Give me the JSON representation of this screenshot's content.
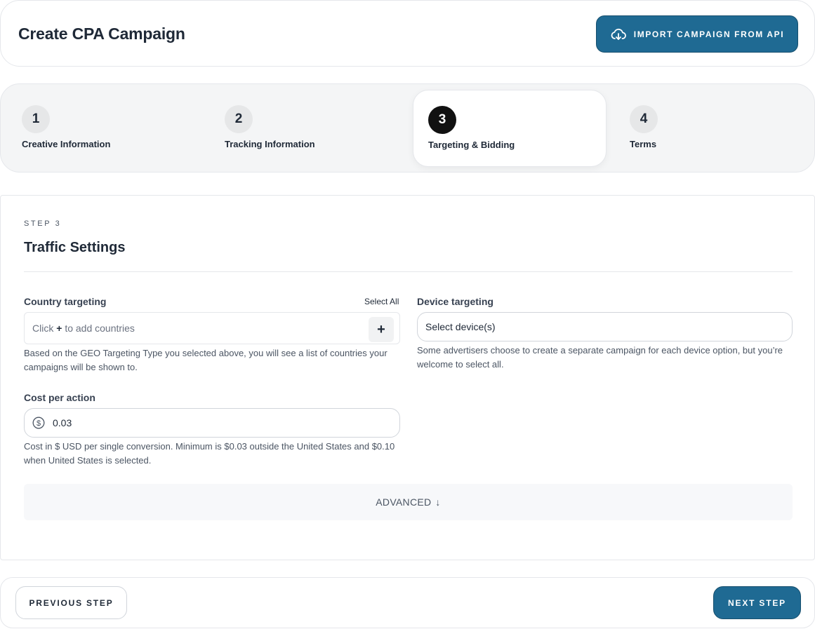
{
  "header": {
    "title": "Create CPA Campaign",
    "import_button": "IMPORT CAMPAIGN FROM API"
  },
  "steps": [
    {
      "number": "1",
      "label": "Creative Information",
      "active": false
    },
    {
      "number": "2",
      "label": "Tracking Information",
      "active": false
    },
    {
      "number": "3",
      "label": "Targeting & Bidding",
      "active": true
    },
    {
      "number": "4",
      "label": "Terms",
      "active": false
    }
  ],
  "form": {
    "kicker": "STEP 3",
    "title": "Traffic Settings",
    "country": {
      "label": "Country targeting",
      "select_all": "Select All",
      "placeholder_prefix": "Click",
      "placeholder_plus": "+",
      "placeholder_suffix": "to add countries",
      "add_button": "+",
      "help": "Based on the GEO Targeting Type you selected above, you will see a list of countries your campaigns will be shown to."
    },
    "device": {
      "label": "Device targeting",
      "value": "Select device(s)",
      "help": "Some advertisers choose to create a separate campaign for each device option, but you’re welcome to select all."
    },
    "cpa": {
      "label": "Cost per action",
      "value": "0.03",
      "help": "Cost in $ USD per single conversion. Minimum is $0.03 outside the United States and $0.10 when United States is selected."
    },
    "advanced": {
      "label": "ADVANCED",
      "arrow": "↓"
    }
  },
  "footer": {
    "prev_label": "PREVIOUS STEP",
    "next_label": "NEXT STEP"
  },
  "colors": {
    "primary": "#1f6a93",
    "active_step": "#111111"
  }
}
